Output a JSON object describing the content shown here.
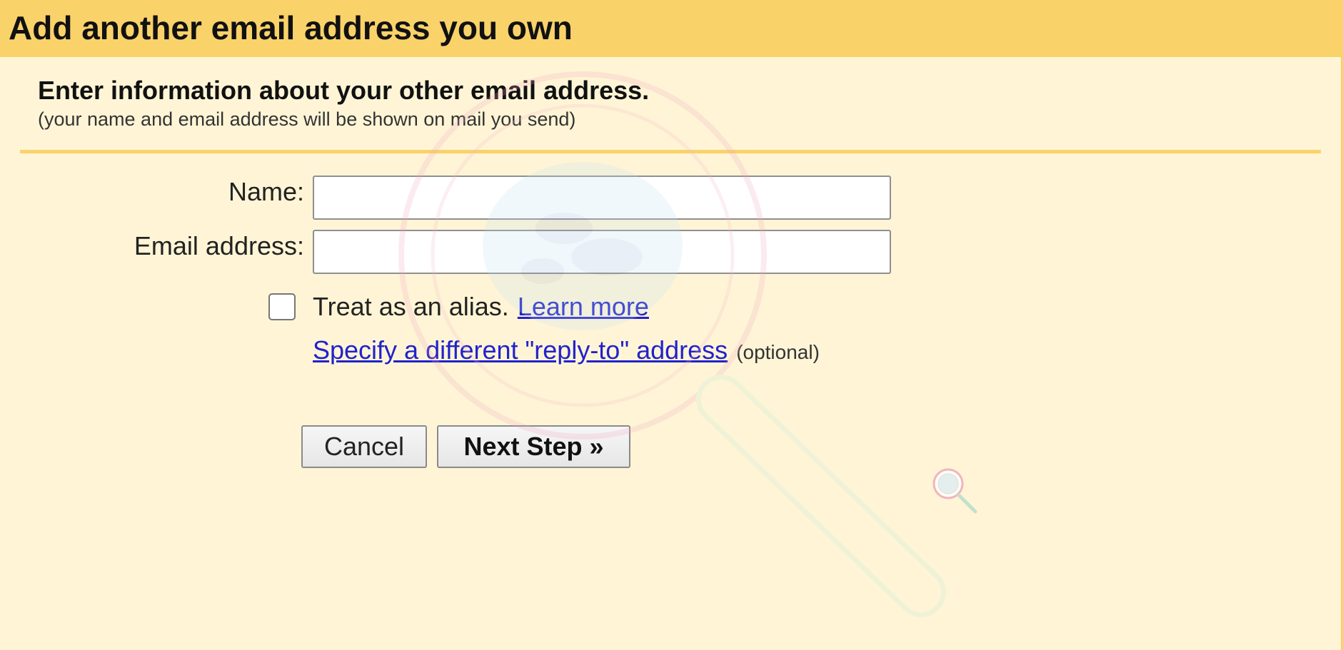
{
  "header": {
    "title": "Add another email address you own"
  },
  "intro": {
    "title": "Enter information about your other email address.",
    "subtitle": "(your name and email address will be shown on mail you send)"
  },
  "form": {
    "name_label": "Name:",
    "name_value": "",
    "email_label": "Email address:",
    "email_value": "",
    "alias_checked": false,
    "alias_text": "Treat as an alias.",
    "learn_more": "Learn more",
    "reply_to_link": "Specify a different \"reply-to\" address",
    "optional": "(optional)"
  },
  "buttons": {
    "cancel": "Cancel",
    "next": "Next Step »"
  },
  "colors": {
    "header_bg": "#fad26a",
    "panel_bg": "#fff5d6",
    "link": "#2222cc"
  },
  "icons": {
    "watermark_large": "magnifier-globe-icon",
    "watermark_small": "magnifier-globe-icon"
  }
}
